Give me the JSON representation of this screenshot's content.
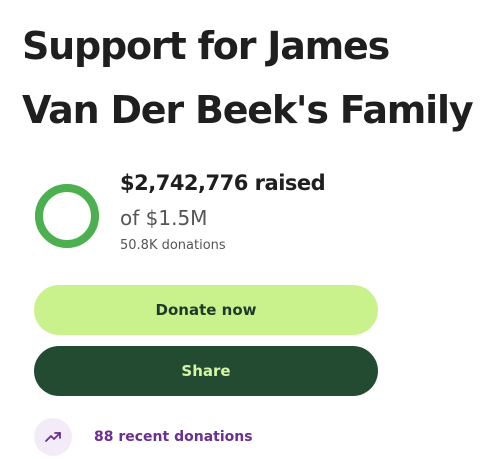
{
  "campaign": {
    "title_line1": "Support for James",
    "title_line2": "Van Der Beek's Family"
  },
  "progress": {
    "raised_text": "$2,742,776 raised",
    "goal_text": "of $1.5M",
    "donations_count": "50.8K donations",
    "fraction": 1.0,
    "ring_color": "#4caf50",
    "ring_track_color": "#a8e07a"
  },
  "actions": {
    "donate_label": "Donate now",
    "share_label": "Share"
  },
  "recent": {
    "label": "88 recent donations",
    "icon": "trending-up-icon"
  },
  "colors": {
    "donate_bg": "#c9f28c",
    "share_bg": "#234b32",
    "recent_accent": "#6b2f8f"
  }
}
